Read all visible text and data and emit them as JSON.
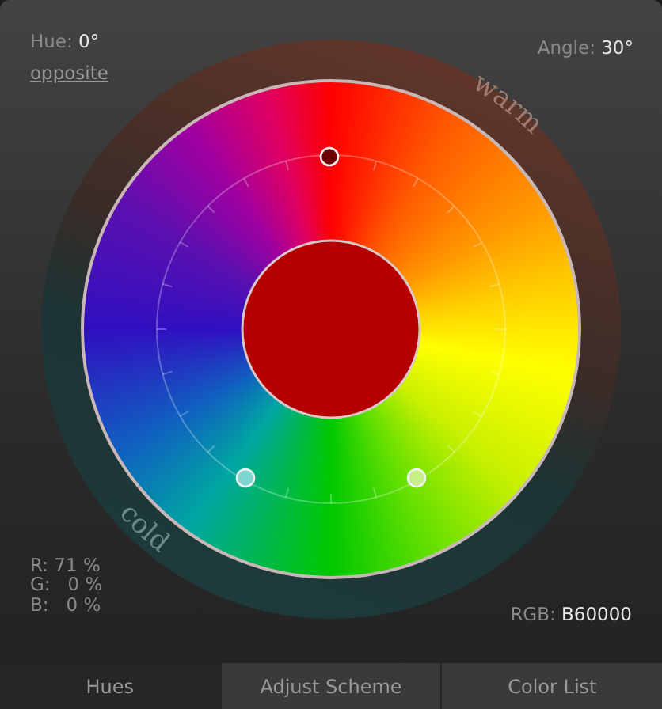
{
  "hue": {
    "label": "Hue:",
    "value": "0°"
  },
  "opposite_link": "opposite",
  "angle": {
    "label": "Angle:",
    "value": "30°"
  },
  "wheel": {
    "warm_label": "warm",
    "cold_label": "cold",
    "markers": [
      {
        "color": "#6a0000"
      },
      {
        "color": "#7fd6d0"
      },
      {
        "color": "#c8f08a"
      }
    ]
  },
  "rgb_percent": [
    {
      "label": "R:",
      "value": "71 %"
    },
    {
      "label": "G:",
      "value": "0 %"
    },
    {
      "label": "B:",
      "value": "0 %"
    }
  ],
  "rgb_hex": {
    "label": "RGB:",
    "value": "B60000"
  },
  "tabs": [
    {
      "label": "Hues",
      "selected": true
    },
    {
      "label": "Adjust Scheme",
      "selected": false
    },
    {
      "label": "Color List",
      "selected": false
    }
  ]
}
